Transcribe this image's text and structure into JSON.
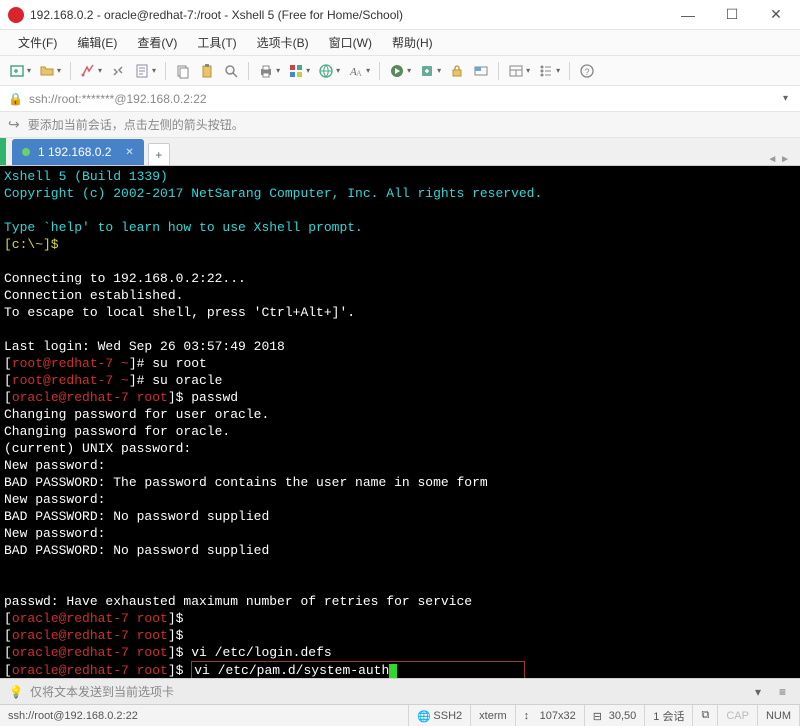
{
  "window": {
    "title": "192.168.0.2 - oracle@redhat-7:/root - Xshell 5 (Free for Home/School)"
  },
  "menu": {
    "file": "文件(F)",
    "edit": "编辑(E)",
    "view": "查看(V)",
    "tools": "工具(T)",
    "tabs": "选项卡(B)",
    "window": "窗口(W)",
    "help": "帮助(H)"
  },
  "address": "ssh://root:*******@192.168.0.2:22",
  "hint": "要添加当前会话，点击左侧的箭头按钮。",
  "tab": {
    "label": "1 192.168.0.2"
  },
  "terminal": {
    "header1": "Xshell 5 (Build 1339)",
    "header2": "Copyright (c) 2002-2017 NetSarang Computer, Inc. All rights reserved.",
    "help": "Type `help' to learn how to use Xshell prompt.",
    "localprompt": "[c:\\~]$",
    "conn1": "Connecting to 192.168.0.2:22...",
    "conn2": "Connection established.",
    "conn3": "To escape to local shell, press 'Ctrl+Alt+]'.",
    "lastlogin": "Last login: Wed Sep 26 03:57:49 2018",
    "rootprompt_user": "root@redhat-7 ~",
    "oracleprompt_user": "oracle@redhat-7 root",
    "su_root": "su root",
    "su_oracle": "su oracle",
    "passwd": "passwd",
    "chg1": "Changing password for user oracle.",
    "chg2": "Changing password for oracle.",
    "curpwd": "(current) UNIX password:",
    "newpwd": "New password:",
    "bad_name": "BAD PASSWORD: The password contains the user name in some form",
    "bad_none": "BAD PASSWORD: No password supplied",
    "exhaust": "passwd: Have exhausted maximum number of retries for service",
    "vi_login": "vi /etc/login.defs",
    "vi_pam": "vi /etc/pam.d/system-auth"
  },
  "msgbar": {
    "text": "仅将文本发送到当前选项卡"
  },
  "status": {
    "ssh": "ssh://root@192.168.0.2:22",
    "proto": "SSH2",
    "term": "xterm",
    "size": "107x32",
    "pos": "30,50",
    "sess": "1 会话",
    "cap": "CAP",
    "num": "NUM"
  }
}
